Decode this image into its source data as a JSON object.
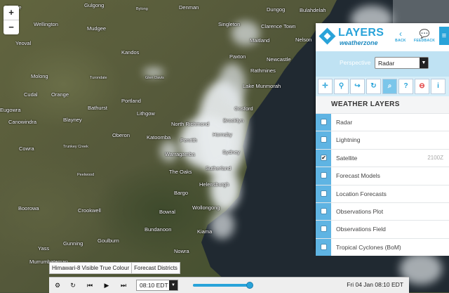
{
  "map": {
    "zoom_in": "+",
    "zoom_out": "−",
    "places": [
      {
        "name": "Geurie",
        "small": false
      },
      {
        "name": "Gulgong",
        "small": false
      },
      {
        "name": "Bylong",
        "small": true
      },
      {
        "name": "Denman",
        "small": false
      },
      {
        "name": "Dungog",
        "small": false
      },
      {
        "name": "Bulahdelah",
        "small": false
      },
      {
        "name": "Wellington",
        "small": false
      },
      {
        "name": "Mudgee",
        "small": false
      },
      {
        "name": "Singleton",
        "small": false
      },
      {
        "name": "Clarence Town",
        "small": false
      },
      {
        "name": "Yeoval",
        "small": false
      },
      {
        "name": "Maitland",
        "small": false
      },
      {
        "name": "Nelson",
        "small": false
      },
      {
        "name": "Kandos",
        "small": false
      },
      {
        "name": "Paxton",
        "small": false
      },
      {
        "name": "Newcastle",
        "small": false
      },
      {
        "name": "Rathmines",
        "small": false
      },
      {
        "name": "Molong",
        "small": false
      },
      {
        "name": "Turondale",
        "small": true
      },
      {
        "name": "Glen Davis",
        "small": true
      },
      {
        "name": "Lake Munmorah",
        "small": false
      },
      {
        "name": "Cudal",
        "small": false
      },
      {
        "name": "Orange",
        "small": false
      },
      {
        "name": "Portland",
        "small": false
      },
      {
        "name": "Gosford",
        "small": false
      },
      {
        "name": "Eugowra",
        "small": false
      },
      {
        "name": "Bathurst",
        "small": false
      },
      {
        "name": "Lithgow",
        "small": false
      },
      {
        "name": "Canowindra",
        "small": false
      },
      {
        "name": "Blayney",
        "small": false
      },
      {
        "name": "North Richmond",
        "small": false
      },
      {
        "name": "Brooklyn",
        "small": false
      },
      {
        "name": "Oberon",
        "small": false
      },
      {
        "name": "Katoomba",
        "small": false
      },
      {
        "name": "Penrith",
        "small": false
      },
      {
        "name": "Hornsby",
        "small": false
      },
      {
        "name": "Cowra",
        "small": false
      },
      {
        "name": "Trunkey Creek",
        "small": true
      },
      {
        "name": "Warragamba",
        "small": false
      },
      {
        "name": "Sydney",
        "small": false
      },
      {
        "name": "The Oaks",
        "small": false
      },
      {
        "name": "Sutherland",
        "small": false
      },
      {
        "name": "Peelwood",
        "small": true
      },
      {
        "name": "Helensburgh",
        "small": false
      },
      {
        "name": "Bargo",
        "small": false
      },
      {
        "name": "Boorowa",
        "small": false
      },
      {
        "name": "Crookwell",
        "small": false
      },
      {
        "name": "Bowral",
        "small": false
      },
      {
        "name": "Wollongong",
        "small": false
      },
      {
        "name": "Bundanoon",
        "small": false
      },
      {
        "name": "Kiama",
        "small": false
      },
      {
        "name": "Gunning",
        "small": false
      },
      {
        "name": "Goulburn",
        "small": false
      },
      {
        "name": "Yass",
        "small": false
      },
      {
        "name": "Nowra",
        "small": false
      },
      {
        "name": "Murrumbateman",
        "small": false
      }
    ]
  },
  "panel": {
    "title": "LAYERS",
    "brand": "weatherzone",
    "back_label": "BACK",
    "feedback_label": "FEEDBACK",
    "perspective_label": "Perspective",
    "perspective_value": "Radar",
    "section_title": "WEATHER LAYERS",
    "layers": [
      {
        "name": "Radar",
        "checked": false,
        "time": ""
      },
      {
        "name": "Lightning",
        "checked": false,
        "time": ""
      },
      {
        "name": "Satellite",
        "checked": true,
        "time": "2100Z"
      },
      {
        "name": "Forecast Models",
        "checked": false,
        "time": ""
      },
      {
        "name": "Location Forecasts",
        "checked": false,
        "time": ""
      },
      {
        "name": "Observations Plot",
        "checked": false,
        "time": ""
      },
      {
        "name": "Observations Field",
        "checked": false,
        "time": ""
      },
      {
        "name": "Tropical Cyclones (BoM)",
        "checked": false,
        "time": ""
      }
    ]
  },
  "info_bar": {
    "layer_name": "Himawari-8 Visible True Colour",
    "districts": "Forecast Districts"
  },
  "player": {
    "time_value": "08:10 EDT",
    "slider_fraction": 0.95,
    "date_label": "Fri 04 Jan 08:10 EDT"
  },
  "colors": {
    "accent": "#29a3d9",
    "ocean": "#202931",
    "land": "#55593a"
  }
}
